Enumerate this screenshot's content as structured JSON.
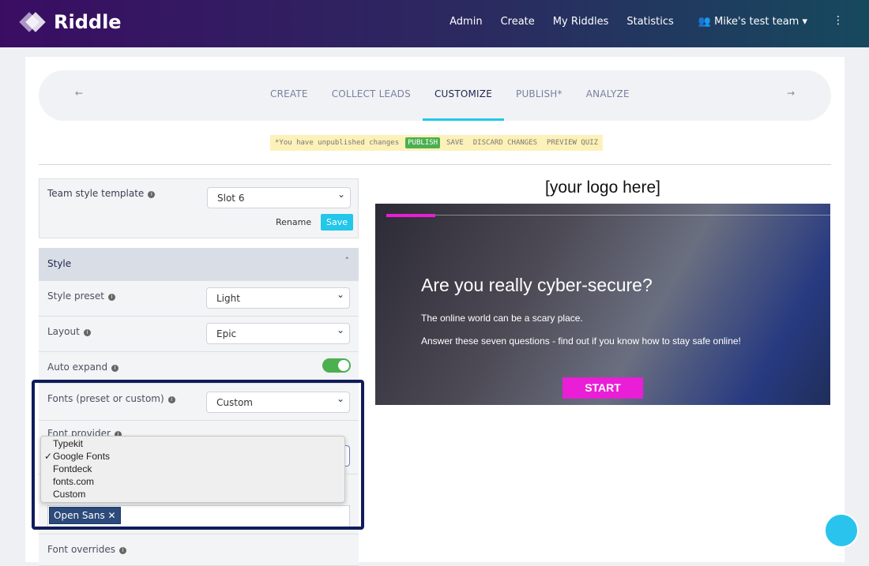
{
  "header": {
    "brand": "Riddle",
    "nav": [
      "Admin",
      "Create",
      "My Riddles",
      "Statistics"
    ],
    "team": "Mike's test team",
    "menu_icon": "kebab-icon"
  },
  "steps": {
    "tabs": [
      "CREATE",
      "COLLECT LEADS",
      "CUSTOMIZE",
      "PUBLISH*",
      "ANALYZE"
    ],
    "active": "CUSTOMIZE",
    "accent": "#22c7ea"
  },
  "notice": {
    "text": "*You have unpublished changes",
    "publish": "PUBLISH",
    "save": "SAVE",
    "discard": "DISCARD CHANGES",
    "preview": "PREVIEW QUIZ"
  },
  "template": {
    "label": "Team style template",
    "value": "Slot 6",
    "rename": "Rename",
    "save": "Save"
  },
  "style": {
    "title": "Style",
    "preset_label": "Style preset",
    "preset_value": "Light",
    "layout_label": "Layout",
    "layout_value": "Epic",
    "auto_expand_label": "Auto expand",
    "auto_expand": true,
    "fonts_label": "Fonts (preset or custom)",
    "fonts_value": "Custom",
    "provider_label": "Font provider",
    "provider_options": [
      "Typekit",
      "Google Fonts",
      "Fontdeck",
      "fonts.com",
      "Custom"
    ],
    "provider_selected": "Google Fonts",
    "font_tag": "Open Sans",
    "overrides_label": "Font overrides"
  },
  "preview": {
    "logo": "[your logo here]",
    "title": "Are you really cyber-secure?",
    "line1": "The online world can be a scary place.",
    "line2": "Answer these seven questions - find out if you know how to stay safe online!",
    "start": "START",
    "accent": "#e91ed6"
  }
}
